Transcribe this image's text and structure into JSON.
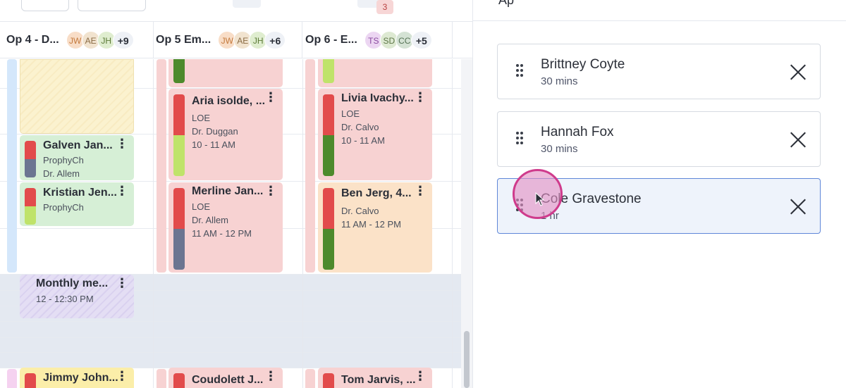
{
  "toolbar": {
    "badge_count": "3",
    "prev_arrow": "‹",
    "next_arrow": "›"
  },
  "operatories": [
    {
      "name": "Op 4 - D...",
      "avatars": [
        "JW",
        "AE",
        "JH"
      ],
      "more": "+9"
    },
    {
      "name": "Op 5 Em...",
      "avatars": [
        "JW",
        "AE",
        "JH"
      ],
      "more": "+6"
    },
    {
      "name": "Op 6 - E...",
      "avatars": [
        "TS",
        "SD",
        "CC"
      ],
      "more": "+5"
    }
  ],
  "appointments": {
    "galven": {
      "title": "Galven Jan...",
      "line1": "ProphyCh",
      "line2": "Dr. Allem"
    },
    "kristian": {
      "title": "Kristian Jen...",
      "line1": "ProphyCh"
    },
    "monthly": {
      "title": "Monthly me...",
      "line1": "12 - 12:30 PM"
    },
    "jimmy": {
      "title": "Jimmy John..."
    },
    "aria": {
      "title": "Aria isolde, ...",
      "line1": "LOE",
      "line2": "Dr. Duggan",
      "line3": "10 - 11 AM"
    },
    "merline": {
      "title": "Merline Jan...",
      "line1": "LOE",
      "line2": "Dr. Allem",
      "line3": "11 AM - 12 PM"
    },
    "coudolett": {
      "title": "Coudolett J..."
    },
    "livia": {
      "title": "Livia Ivachy...",
      "line1": "LOE",
      "line2": "Dr. Calvo",
      "line3": "10 - 11 AM"
    },
    "ben": {
      "title": "Ben Jerg, 4...",
      "line1": "Dr. Calvo",
      "line2": "11 AM - 12 PM"
    },
    "tom": {
      "title": "Tom Jarvis, ..."
    }
  },
  "panel": {
    "header": "Ap",
    "cards": [
      {
        "name": "Brittney Coyte",
        "duration": "30 mins"
      },
      {
        "name": "Hannah Fox",
        "duration": "30 mins"
      },
      {
        "name": "Cole Gravestone",
        "duration": "1 hr"
      }
    ]
  },
  "icons": {
    "kebab": "⋮",
    "grip": "drag-handle-icon",
    "close": "close-icon"
  }
}
